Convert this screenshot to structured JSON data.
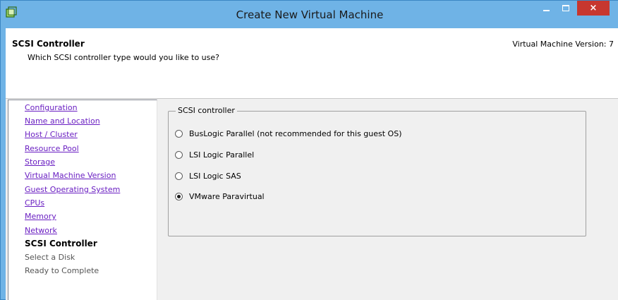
{
  "window": {
    "title": "Create New Virtual Machine",
    "icon": "vm-app-icon",
    "close_glyph": "×"
  },
  "header": {
    "title": "SCSI Controller",
    "subtitle": "Which SCSI controller type would you like to use?",
    "version": "Virtual Machine Version: 7"
  },
  "nav": {
    "items": [
      {
        "label": "Configuration",
        "state": "completed"
      },
      {
        "label": "Name and Location",
        "state": "completed"
      },
      {
        "label": "Host / Cluster",
        "state": "completed"
      },
      {
        "label": "Resource Pool",
        "state": "completed"
      },
      {
        "label": "Storage",
        "state": "completed"
      },
      {
        "label": "Virtual Machine Version",
        "state": "completed"
      },
      {
        "label": "Guest Operating System",
        "state": "completed"
      },
      {
        "label": "CPUs",
        "state": "completed"
      },
      {
        "label": "Memory",
        "state": "completed"
      },
      {
        "label": "Network",
        "state": "completed"
      },
      {
        "label": "SCSI Controller",
        "state": "current"
      },
      {
        "label": "Select a Disk",
        "state": "pending"
      },
      {
        "label": "Ready to Complete",
        "state": "pending"
      }
    ]
  },
  "scsi_group": {
    "legend": "SCSI controller",
    "options": [
      {
        "label": "BusLogic Parallel (not recommended for this guest OS)",
        "selected": false
      },
      {
        "label": "LSI Logic Parallel",
        "selected": false
      },
      {
        "label": "LSI Logic SAS",
        "selected": false
      },
      {
        "label": "VMware Paravirtual",
        "selected": true
      }
    ]
  },
  "colors": {
    "titlebar": "#6fb3e6",
    "close_button": "#c7372f",
    "link": "#6a1fc2"
  }
}
